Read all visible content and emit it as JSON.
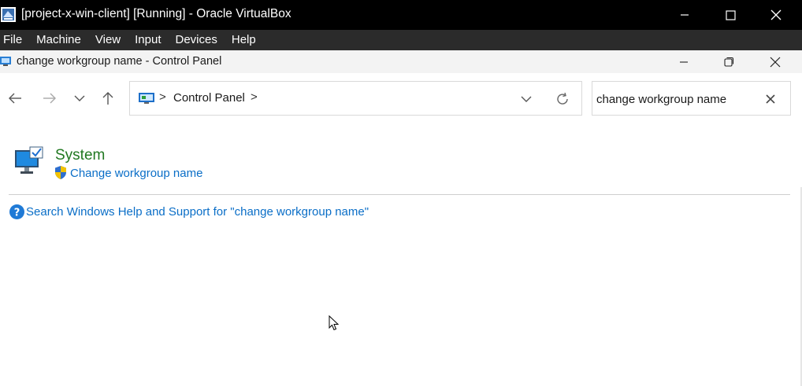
{
  "host": {
    "title": "[project-x-win-client] [Running] - Oracle VirtualBox",
    "menu": [
      "File",
      "Machine",
      "View",
      "Input",
      "Devices",
      "Help"
    ]
  },
  "window": {
    "title": "change workgroup name - Control Panel"
  },
  "address": {
    "breadcrumb": "Control Panel",
    "separator": ">"
  },
  "search": {
    "value": "change workgroup name"
  },
  "results": {
    "heading": "System",
    "task_link": "Change workgroup name",
    "help_link": "Search Windows Help and Support for \"change workgroup name\""
  },
  "colors": {
    "heading_green": "#217821",
    "link_blue": "#0a6ec7",
    "host_titlebar": "#000000",
    "host_menubar": "#2b2b2b"
  }
}
